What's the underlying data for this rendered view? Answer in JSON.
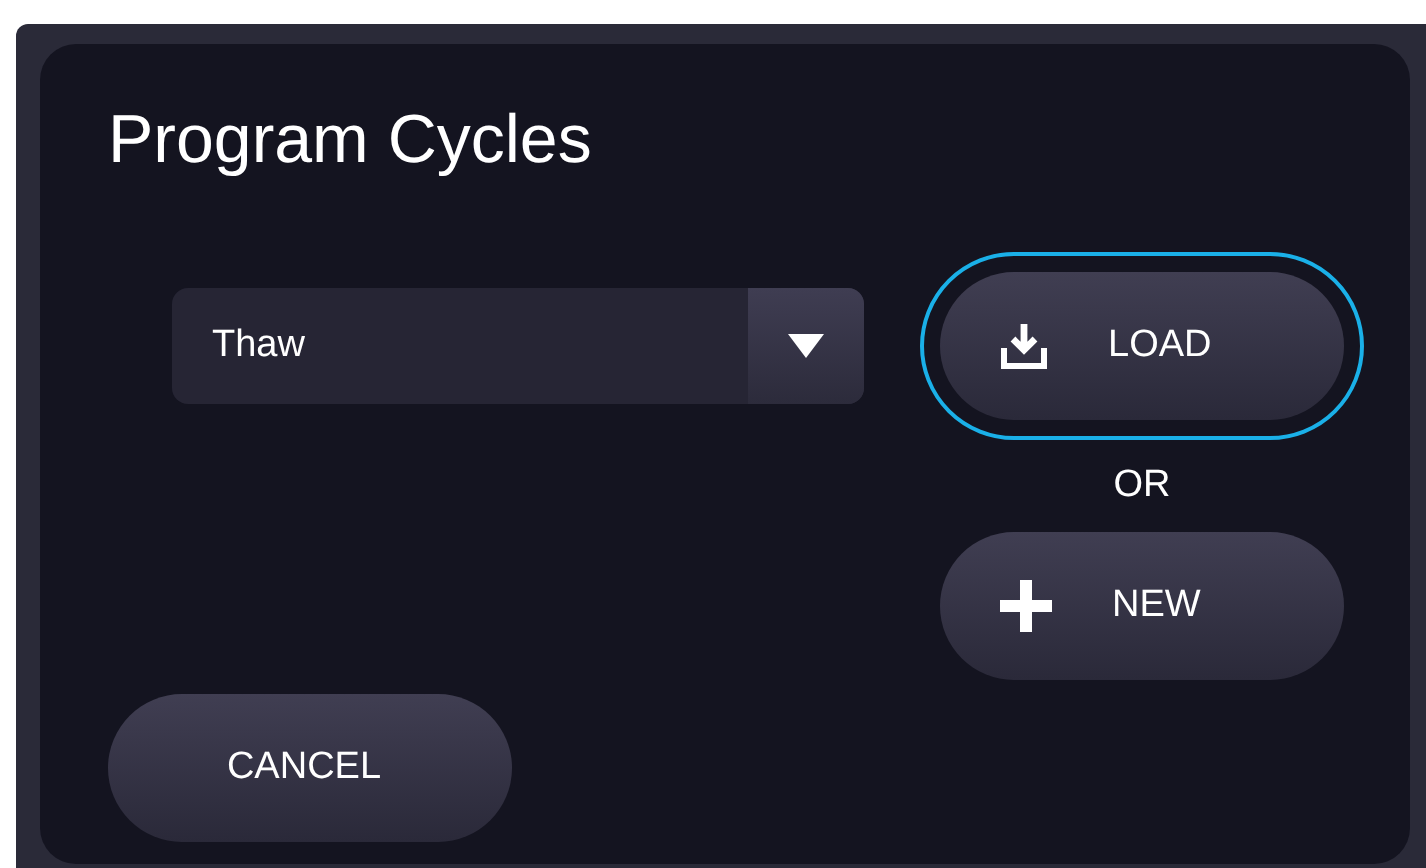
{
  "dialog": {
    "title": "Program Cycles"
  },
  "cycle_select": {
    "value": "Thaw"
  },
  "load_button": {
    "label": "LOAD",
    "focused": true
  },
  "separator": "OR",
  "new_button": {
    "label": "NEW",
    "focused": false
  },
  "cancel_button": {
    "label": "CANCEL",
    "focused": false
  }
}
